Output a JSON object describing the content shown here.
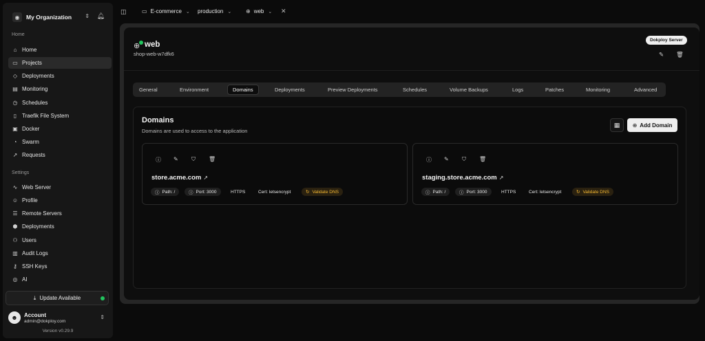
{
  "sidebar": {
    "org_name": "My Organization",
    "home_label": "Home",
    "settings_label": "Settings",
    "main_items": [
      {
        "label": "Home",
        "icon": "home-icon"
      },
      {
        "label": "Projects",
        "icon": "folder-icon"
      },
      {
        "label": "Deployments",
        "icon": "layers-icon"
      },
      {
        "label": "Monitoring",
        "icon": "bar-chart-icon"
      },
      {
        "label": "Schedules",
        "icon": "clock-icon"
      },
      {
        "label": "Traefik File System",
        "icon": "file-icon"
      },
      {
        "label": "Docker",
        "icon": "box-icon"
      },
      {
        "label": "Swarm",
        "icon": "pie-icon"
      },
      {
        "label": "Requests",
        "icon": "arrow-icon"
      }
    ],
    "settings_items": [
      {
        "label": "Web Server",
        "icon": "activity-icon"
      },
      {
        "label": "Profile",
        "icon": "user-icon"
      },
      {
        "label": "Remote Servers",
        "icon": "server-icon"
      },
      {
        "label": "Deployments",
        "icon": "boxes-icon"
      },
      {
        "label": "Users",
        "icon": "users-icon"
      },
      {
        "label": "Audit Logs",
        "icon": "log-icon"
      },
      {
        "label": "SSH Keys",
        "icon": "key-icon"
      },
      {
        "label": "AI",
        "icon": "bot-icon"
      }
    ],
    "update_label": "Update Available",
    "account_name": "Account",
    "account_email": "admin@dokploy.com",
    "version": "Version v0.29.9"
  },
  "topbar": {
    "project": "E-commerce",
    "environment": "production",
    "service": "web"
  },
  "service": {
    "name": "web",
    "app_name": "shop-web-w7dfk6",
    "server_badge": "Dokploy Server"
  },
  "tabs": [
    "General",
    "Environment",
    "Domains",
    "Deployments",
    "Preview Deployments",
    "Schedules",
    "Volume Backups",
    "Logs",
    "Patches",
    "Monitoring",
    "Advanced"
  ],
  "domains": {
    "title": "Domains",
    "description": "Domains are used to access to the application",
    "add_label": "Add Domain",
    "items": [
      {
        "host": "store.acme.com",
        "path": "Path: /",
        "port": "Port: 3000",
        "protocol": "HTTPS",
        "cert": "Cert: letsencrypt",
        "validate": "Validate DNS"
      },
      {
        "host": "staging.store.acme.com",
        "path": "Path: /",
        "port": "Port: 3000",
        "protocol": "HTTPS",
        "cert": "Cert: letsencrypt",
        "validate": "Validate DNS"
      }
    ]
  },
  "colors": {
    "accent_green": "#22c55e",
    "warn": "#f5b932"
  }
}
